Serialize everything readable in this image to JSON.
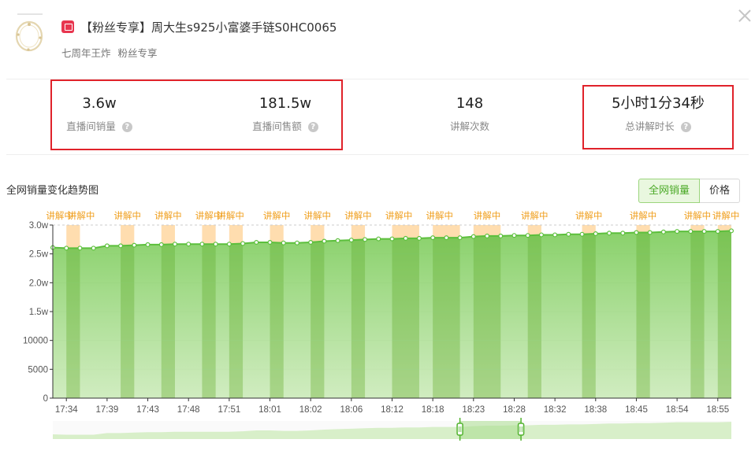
{
  "product": {
    "tag_icon": "fan-exclusive-badge-icon",
    "title": "【粉丝专享】周大生s925小富婆手链S0HC0065",
    "meta": [
      "七周年王炸",
      "粉丝专享"
    ]
  },
  "stats": [
    {
      "value": "3.6w",
      "label": "直播间销量",
      "help": true
    },
    {
      "value": "181.5w",
      "label": "直播间售额",
      "help": true
    },
    {
      "value": "148",
      "label": "讲解次数",
      "help": false
    },
    {
      "value": "5小时1分34秒",
      "label": "总讲解时长",
      "help": true
    }
  ],
  "colors": {
    "highlight": "#e0222a",
    "accent": "#5cbf3c",
    "explain": "#ffd9a6",
    "explain_text": "#f0a020"
  },
  "chart_section": {
    "title": "全网销量变化趋势图",
    "tabs": [
      {
        "label": "全网销量",
        "active": true
      },
      {
        "label": "价格",
        "active": false
      }
    ]
  },
  "chart_data": {
    "type": "area",
    "title": "",
    "xlabel": "",
    "ylabel": "",
    "ylim": [
      0,
      30000
    ],
    "grid": true,
    "y_ticks": [
      {
        "v": 0,
        "label": "0"
      },
      {
        "v": 5000,
        "label": "5000"
      },
      {
        "v": 10000,
        "label": "10000"
      },
      {
        "v": 15000,
        "label": "1.5w"
      },
      {
        "v": 20000,
        "label": "2.0w"
      },
      {
        "v": 25000,
        "label": "2.5w"
      },
      {
        "v": 30000,
        "label": "3.0w"
      }
    ],
    "x_ticks": [
      {
        "i": 1,
        "label": "17:34"
      },
      {
        "i": 4,
        "label": "17:39"
      },
      {
        "i": 7,
        "label": "17:43"
      },
      {
        "i": 10,
        "label": "17:48"
      },
      {
        "i": 13,
        "label": "17:51"
      },
      {
        "i": 16,
        "label": "18:01"
      },
      {
        "i": 19,
        "label": "18:02"
      },
      {
        "i": 22,
        "label": "18:06"
      },
      {
        "i": 25,
        "label": "18:12"
      },
      {
        "i": 28,
        "label": "18:18"
      },
      {
        "i": 31,
        "label": "18:23"
      },
      {
        "i": 34,
        "label": "18:28"
      },
      {
        "i": 37,
        "label": "18:32"
      },
      {
        "i": 40,
        "label": "18:38"
      },
      {
        "i": 43,
        "label": "18:45"
      },
      {
        "i": 46,
        "label": "18:54"
      },
      {
        "i": 49,
        "label": "18:55"
      }
    ],
    "values": [
      26100,
      26000,
      26000,
      26000,
      26400,
      26400,
      26500,
      26600,
      26600,
      26700,
      26700,
      26700,
      26700,
      26700,
      26800,
      27000,
      27000,
      26900,
      26900,
      27000,
      27200,
      27300,
      27400,
      27500,
      27600,
      27600,
      27700,
      27700,
      27800,
      27800,
      27800,
      28000,
      28100,
      28100,
      28200,
      28200,
      28300,
      28300,
      28400,
      28400,
      28500,
      28600,
      28600,
      28700,
      28700,
      28800,
      28900,
      28900,
      28900,
      28900,
      29000
    ],
    "explain_bands": [
      [
        1,
        2
      ],
      [
        5,
        6
      ],
      [
        8,
        9
      ],
      [
        11,
        12
      ],
      [
        13,
        14
      ],
      [
        16,
        17
      ],
      [
        19,
        20
      ],
      [
        22,
        23
      ],
      [
        25,
        27
      ],
      [
        28,
        30
      ],
      [
        31,
        33
      ],
      [
        35,
        36
      ],
      [
        39,
        40
      ],
      [
        43,
        44
      ],
      [
        47,
        48
      ],
      [
        49,
        50
      ]
    ],
    "explain_labels": [
      {
        "i": 0.5,
        "text": "讲解中"
      },
      {
        "i": 2.1,
        "text": "讲解中"
      },
      {
        "i": 5.5,
        "text": "讲解中"
      },
      {
        "i": 8.5,
        "text": "讲解中"
      },
      {
        "i": 11.5,
        "text": "讲解中"
      },
      {
        "i": 13.1,
        "text": "讲解中"
      },
      {
        "i": 16.5,
        "text": "讲解中"
      },
      {
        "i": 19.5,
        "text": "讲解中"
      },
      {
        "i": 22.5,
        "text": "讲解中"
      },
      {
        "i": 25.5,
        "text": "讲解中"
      },
      {
        "i": 28.5,
        "text": "讲解中"
      },
      {
        "i": 32,
        "text": "讲解中"
      },
      {
        "i": 35.5,
        "text": "讲解中"
      },
      {
        "i": 39.5,
        "text": "讲解中"
      },
      {
        "i": 43.5,
        "text": "讲解中"
      },
      {
        "i": 47.5,
        "text": "讲解中"
      },
      {
        "i": 49.6,
        "text": "讲解中"
      }
    ],
    "zoom_window": [
      0.6,
      0.69
    ]
  }
}
